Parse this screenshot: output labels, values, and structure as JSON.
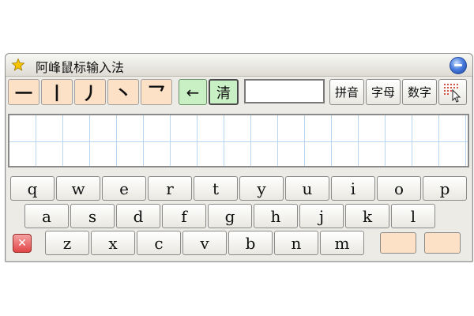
{
  "title": "阿峰鼠标输入法",
  "strokes": [
    "一",
    "丨",
    "丿",
    "丶",
    "乛"
  ],
  "controls": {
    "backspace": "←",
    "clear": "清"
  },
  "input_value": "",
  "modes": [
    "拼音",
    "字母",
    "数字"
  ],
  "keyboard": {
    "row1": [
      "q",
      "w",
      "e",
      "r",
      "t",
      "y",
      "u",
      "i",
      "o",
      "p"
    ],
    "row2": [
      "a",
      "s",
      "d",
      "f",
      "g",
      "h",
      "j",
      "k",
      "l"
    ],
    "row3": [
      "z",
      "x",
      "c",
      "v",
      "b",
      "n",
      "m"
    ]
  },
  "colors": {
    "stroke_key": "#fde1c6",
    "accent_green": "#c9f0c5",
    "grid_line": "#b9d6f0"
  },
  "icons": {
    "app": "star-icon",
    "title_button": "minimize-icon",
    "close": "close-icon",
    "grid": "grid-cursor-icon"
  }
}
